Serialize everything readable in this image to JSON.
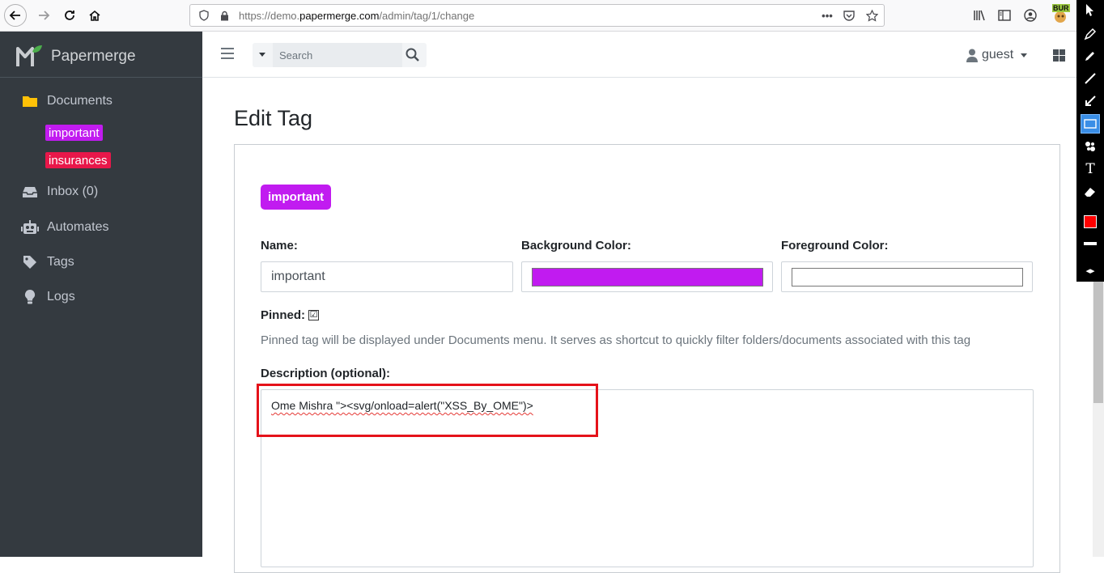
{
  "browser": {
    "url_prefix": "https://demo.",
    "url_domain": "papermerge.com",
    "url_path": "/admin/tag/1/change",
    "extension_badge": "BUR"
  },
  "sidebar": {
    "brand_name": "Papermerge",
    "items": [
      {
        "label": "Documents",
        "icon": "folder-icon"
      },
      {
        "label": "Inbox (0)",
        "icon": "inbox-icon"
      },
      {
        "label": "Automates",
        "icon": "robot-icon"
      },
      {
        "label": "Tags",
        "icon": "tag-icon"
      },
      {
        "label": "Logs",
        "icon": "lightbulb-icon"
      }
    ],
    "pinned_tags": [
      {
        "label": "important",
        "color": "#c11bf0"
      },
      {
        "label": "insurances",
        "color": "#e8174a"
      }
    ]
  },
  "topnav": {
    "search_placeholder": "Search",
    "user": "guest"
  },
  "form": {
    "title": "Edit Tag",
    "preview_tag": "important",
    "name_label": "Name:",
    "name_value": "important",
    "bg_label": "Background Color:",
    "bg_color": "#c11bf0",
    "fg_label": "Foreground Color:",
    "fg_color": "#ffffff",
    "pinned_label": "Pinned:",
    "pinned_check": "☑",
    "pinned_help": "Pinned tag will be displayed under Documents menu. It serves as shortcut to quickly filter folders/documents associated with this tag",
    "description_label": "Description (optional):",
    "description_value": "Ome Mishra \"><svg/onload=alert(\"XSS_By_OME\")>"
  },
  "colors": {
    "sidebar_bg": "#343a40",
    "highlight": "#e5121a"
  }
}
